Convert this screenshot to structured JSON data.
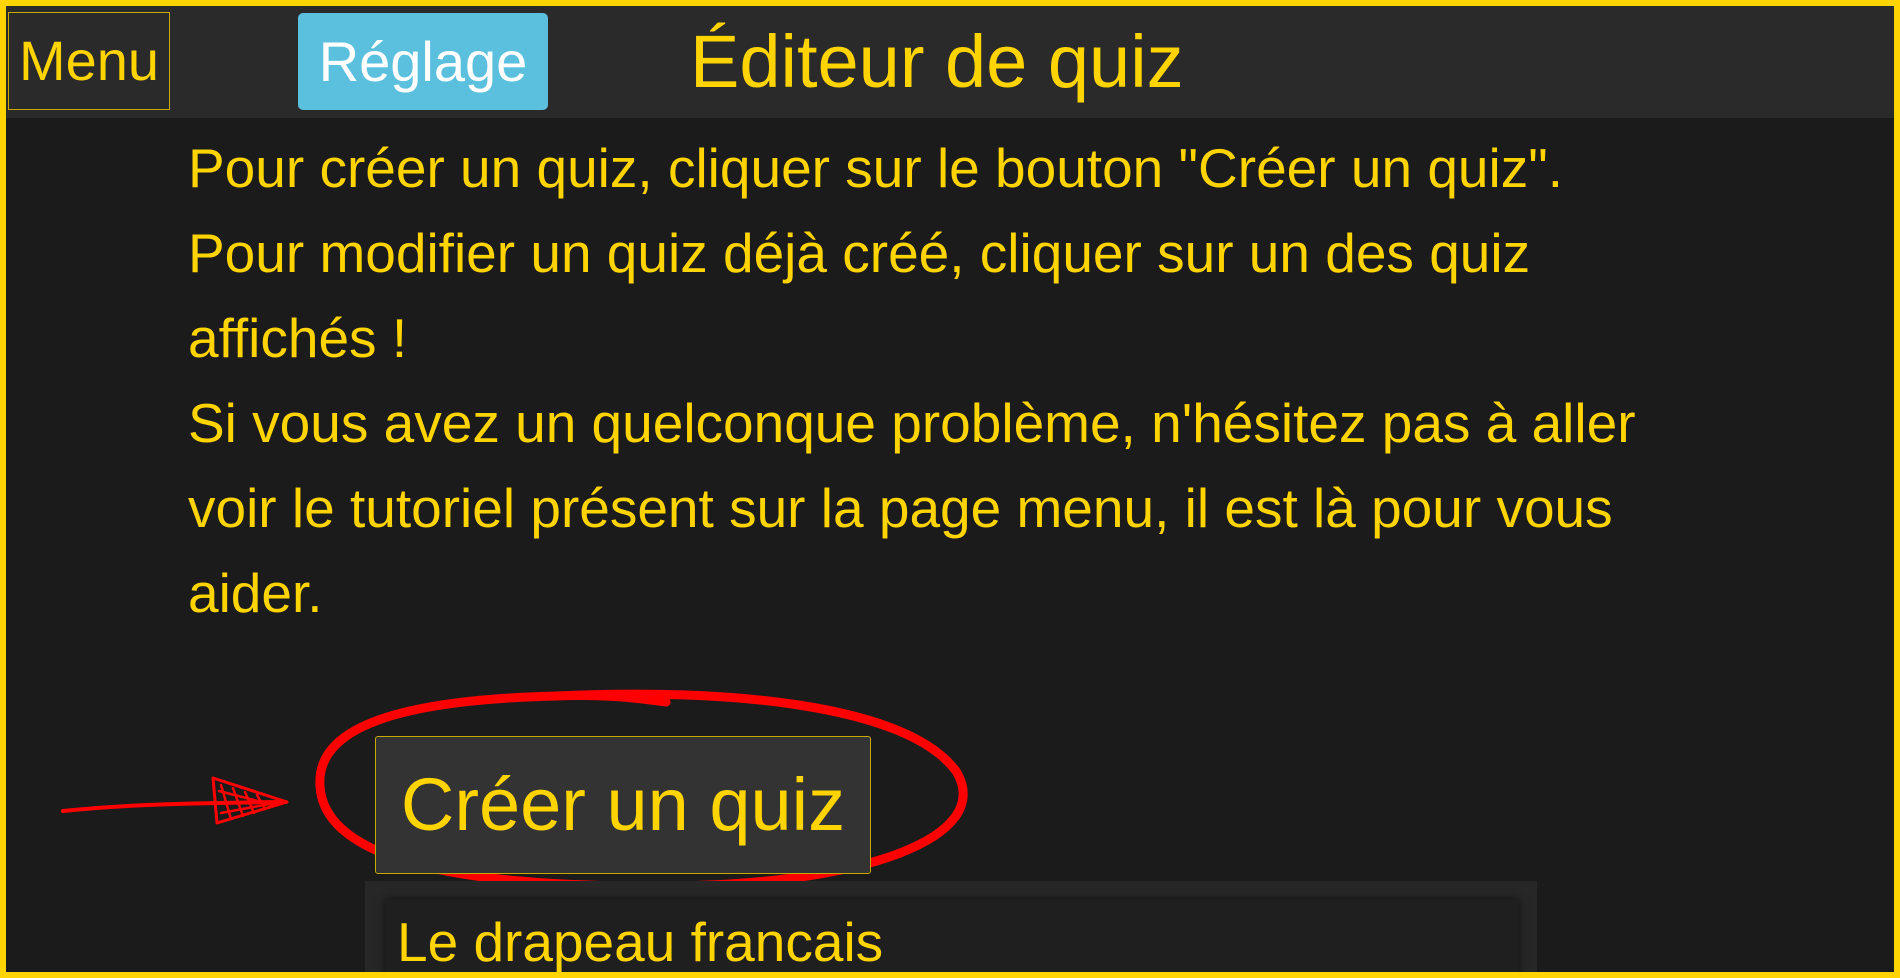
{
  "header": {
    "menu_label": "Menu",
    "settings_label": "Réglage",
    "title": "Éditeur de quiz"
  },
  "instructions": {
    "line1": "Pour créer un quiz, cliquer sur le bouton \"Créer un quiz\".",
    "line2": "Pour modifier un quiz déjà créé, cliquer sur un des quiz affichés !",
    "line3": "Si vous avez un quelconque problème, n'hésitez pas à aller voir le tutoriel présent sur la page menu, il est là pour vous aider."
  },
  "actions": {
    "create_label": "Créer un quiz"
  },
  "quiz_list": {
    "items": [
      {
        "title": "Le drapeau francais"
      }
    ]
  },
  "annotation": {
    "arrow_icon": "hand-drawn-arrow-icon",
    "circle_icon": "hand-drawn-circle-highlight",
    "color": "#ff0000"
  },
  "colors": {
    "accent": "#ffd400",
    "background": "#1b1b1b",
    "topbar": "#2a2a2a",
    "settings_button": "#5bc0de"
  }
}
